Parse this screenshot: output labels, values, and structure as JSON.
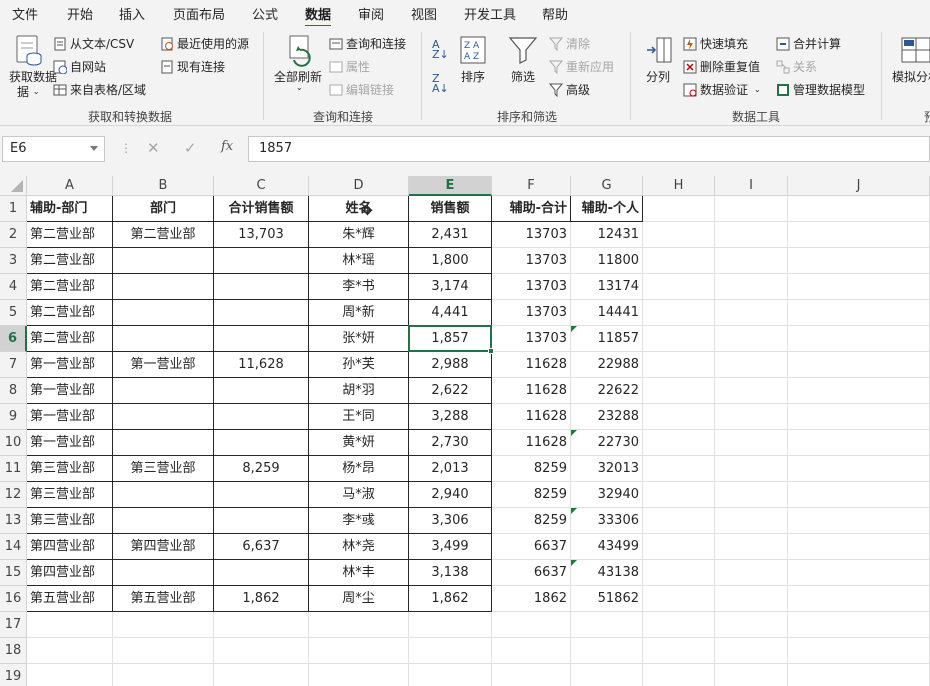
{
  "menu": {
    "tabs": [
      "文件",
      "开始",
      "插入",
      "页面布局",
      "公式",
      "数据",
      "审阅",
      "视图",
      "开发工具",
      "帮助"
    ],
    "active": "数据"
  },
  "ribbon": {
    "get_data": "获取数据",
    "get_data_line2": "据",
    "from_text_csv": "从文本/CSV",
    "from_web": "自网站",
    "from_table": "来自表格/区域",
    "recent_sources": "最近使用的源",
    "existing_connections": "现有连接",
    "group1": "获取和转换数据",
    "refresh_all": "全部刷新",
    "queries_connections": "查询和连接",
    "properties": "属性",
    "edit_links": "编辑链接",
    "group2": "查询和连接",
    "sort": "排序",
    "filter": "筛选",
    "clear": "清除",
    "reapply": "重新应用",
    "advanced": "高级",
    "group3": "排序和筛选",
    "text_to_columns": "分列",
    "flash_fill": "快速填充",
    "remove_duplicates": "删除重复值",
    "data_validation": "数据验证",
    "consolidate": "合并计算",
    "relationships": "关系",
    "manage_model": "管理数据模型",
    "group4": "数据工具",
    "what_if": "模拟分析",
    "group5": "预"
  },
  "formula_bar": {
    "name_box": "E6",
    "formula": "1857"
  },
  "columns": [
    "A",
    "B",
    "C",
    "D",
    "E",
    "F",
    "G",
    "H",
    "I",
    "J"
  ],
  "rows": [
    "1",
    "2",
    "3",
    "4",
    "5",
    "6",
    "7",
    "8",
    "9",
    "10",
    "11",
    "12",
    "13",
    "14",
    "15",
    "16",
    "17",
    "18",
    "19"
  ],
  "selected": {
    "column": "E",
    "row": "6"
  },
  "table": {
    "headers": [
      "辅助-部门",
      "部门",
      "合计销售额",
      "姓名",
      "销售额",
      "辅助-合计",
      "辅助-个人"
    ],
    "rows": [
      [
        "第二营业部",
        "第二营业部",
        "13,703",
        "朱*辉",
        "2,431",
        "13703",
        "12431"
      ],
      [
        "第二营业部",
        "",
        "",
        "林*瑶",
        "1,800",
        "13703",
        "11800"
      ],
      [
        "第二营业部",
        "",
        "",
        "李*书",
        "3,174",
        "13703",
        "13174"
      ],
      [
        "第二营业部",
        "",
        "",
        "周*新",
        "4,441",
        "13703",
        "14441"
      ],
      [
        "第二营业部",
        "",
        "",
        "张*妍",
        "1,857",
        "13703",
        "11857"
      ],
      [
        "第一营业部",
        "第一营业部",
        "11,628",
        "孙*芙",
        "2,988",
        "11628",
        "22988"
      ],
      [
        "第一营业部",
        "",
        "",
        "胡*羽",
        "2,622",
        "11628",
        "22622"
      ],
      [
        "第一营业部",
        "",
        "",
        "王*同",
        "3,288",
        "11628",
        "23288"
      ],
      [
        "第一营业部",
        "",
        "",
        "黄*妍",
        "2,730",
        "11628",
        "22730"
      ],
      [
        "第三营业部",
        "第三营业部",
        "8,259",
        "杨*昂",
        "2,013",
        "8259",
        "32013"
      ],
      [
        "第三营业部",
        "",
        "",
        "马*淑",
        "2,940",
        "8259",
        "32940"
      ],
      [
        "第三营业部",
        "",
        "",
        "李*彧",
        "3,306",
        "8259",
        "33306"
      ],
      [
        "第四营业部",
        "第四营业部",
        "6,637",
        "林*尧",
        "3,499",
        "6637",
        "43499"
      ],
      [
        "第四营业部",
        "",
        "",
        "林*丰",
        "3,138",
        "6637",
        "43138"
      ],
      [
        "第五营业部",
        "第五营业部",
        "1,862",
        "周*尘",
        "1,862",
        "1862",
        "51862"
      ]
    ],
    "green_triangle_rows": [
      5,
      9,
      12,
      14
    ]
  }
}
